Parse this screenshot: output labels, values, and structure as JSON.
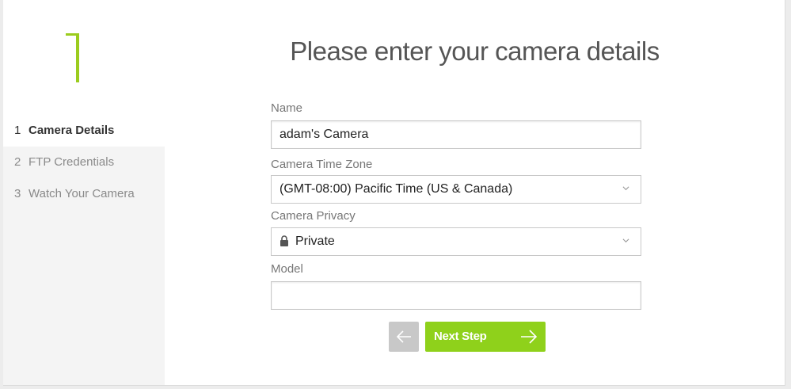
{
  "sidebar": {
    "current_step_number": "1",
    "steps": [
      {
        "number": "1",
        "label": "Camera Details"
      },
      {
        "number": "2",
        "label": "FTP Credentials"
      },
      {
        "number": "3",
        "label": "Watch Your Camera"
      }
    ]
  },
  "main": {
    "title": "Please enter your camera details",
    "name": {
      "label": "Name",
      "value": "adam's Camera"
    },
    "timezone": {
      "label": "Camera Time Zone",
      "value": "(GMT-08:00) Pacific Time (US & Canada)"
    },
    "privacy": {
      "label": "Camera Privacy",
      "value": "Private"
    },
    "model": {
      "label": "Model",
      "value": ""
    }
  },
  "buttons": {
    "next_label": "Next Step"
  },
  "colors": {
    "accent": "#8fd11b",
    "step_number": "#9bcc1e",
    "back_button": "#c8c8c8"
  },
  "icons": {
    "back": "arrow-left-icon",
    "next": "arrow-right-icon",
    "select": "chevron-down-icon",
    "privacy": "lock-icon"
  }
}
